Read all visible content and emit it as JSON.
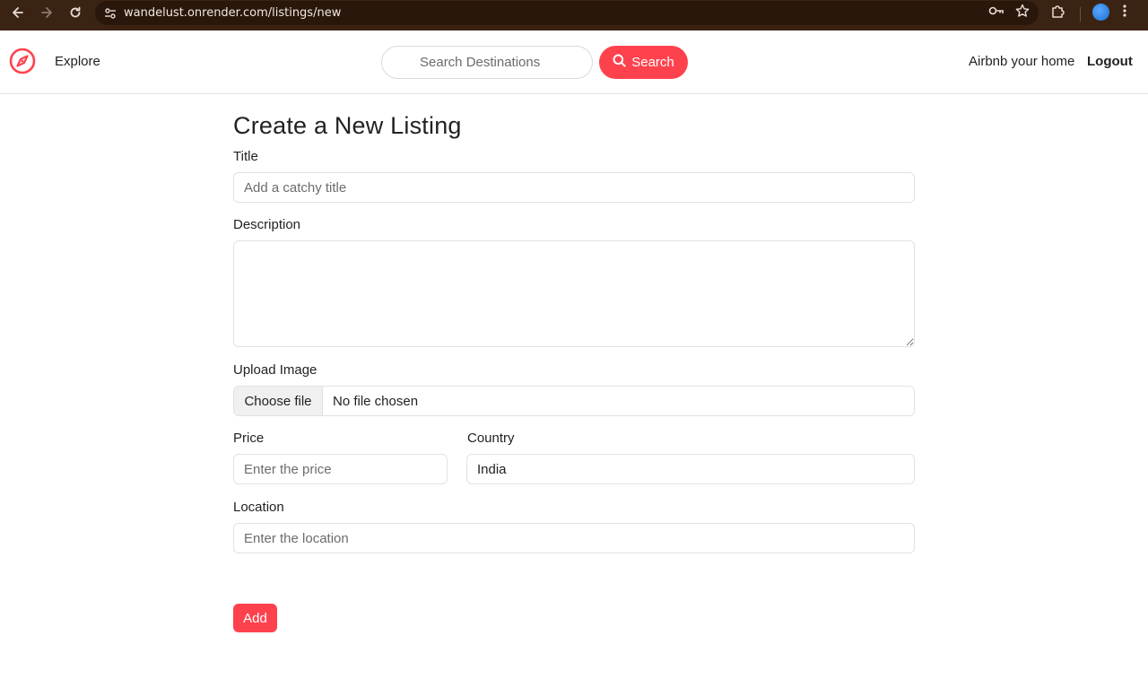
{
  "browser": {
    "url": "wandelust.onrender.com/listings/new"
  },
  "navbar": {
    "explore_label": "Explore",
    "search_placeholder": "Search Destinations",
    "search_button_label": "Search",
    "host_link_label": "Airbnb your home",
    "logout_label": "Logout",
    "brand_color": "#fe424d"
  },
  "form": {
    "title": "Create a New Listing",
    "title_label": "Title",
    "title_placeholder": "Add a catchy title",
    "description_label": "Description",
    "description_value": "",
    "image_label": "Upload Image",
    "file_button_label": "Choose file",
    "file_status": "No file chosen",
    "price_label": "Price",
    "price_placeholder": "Enter the price",
    "country_label": "Country",
    "country_value": "India",
    "location_label": "Location",
    "location_placeholder": "Enter the location",
    "submit_label": "Add"
  }
}
